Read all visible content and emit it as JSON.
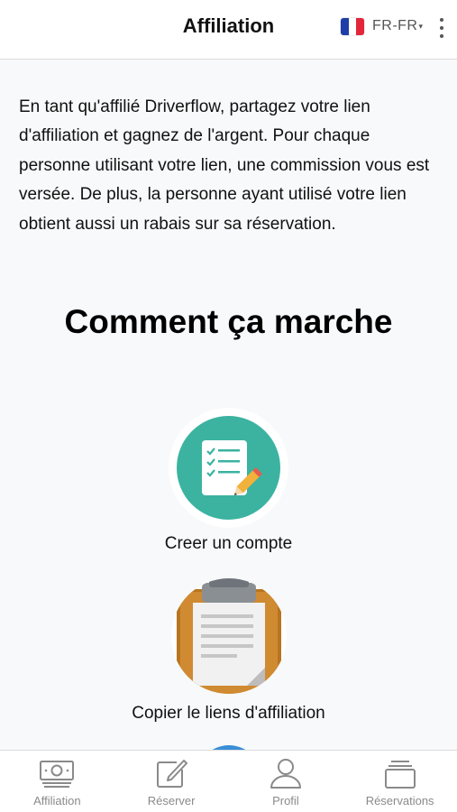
{
  "header": {
    "title": "Affiliation",
    "language": {
      "code": "FR-FR",
      "flag_icon": "france-flag-icon",
      "caret": "▾"
    },
    "menu_icon": "more-vertical-icon"
  },
  "intro": {
    "text": "En tant qu'affilié Driverflow, partagez votre lien d'affiliation et gagnez de l'argent. Pour chaque personne utilisant votre lien, une commission vous est versée. De plus, la personne ayant utilisé votre lien obtient aussi un rabais sur sa réservation."
  },
  "how_it_works": {
    "title": "Comment ça marche",
    "steps": [
      {
        "label": "Creer un compte",
        "icon": "checklist-pencil-icon",
        "color": "#3bb3a0"
      },
      {
        "label": "Copier le liens d'affiliation",
        "icon": "clipboard-icon",
        "color": "#c9822d"
      },
      {
        "label": "",
        "icon": "step-three-icon",
        "color": "#3a8ed8"
      }
    ]
  },
  "bottom_nav": {
    "items": [
      {
        "label": "Affiliation",
        "icon": "money-icon"
      },
      {
        "label": "Réserver",
        "icon": "edit-icon"
      },
      {
        "label": "Profil",
        "icon": "user-icon"
      },
      {
        "label": "Réservations",
        "icon": "stack-icon"
      }
    ]
  },
  "colors": {
    "accent_teal": "#3bb3a0",
    "clipboard_brown": "#c9822d",
    "nav_text": "#8a8a8a",
    "background": "#f8f9fa"
  }
}
